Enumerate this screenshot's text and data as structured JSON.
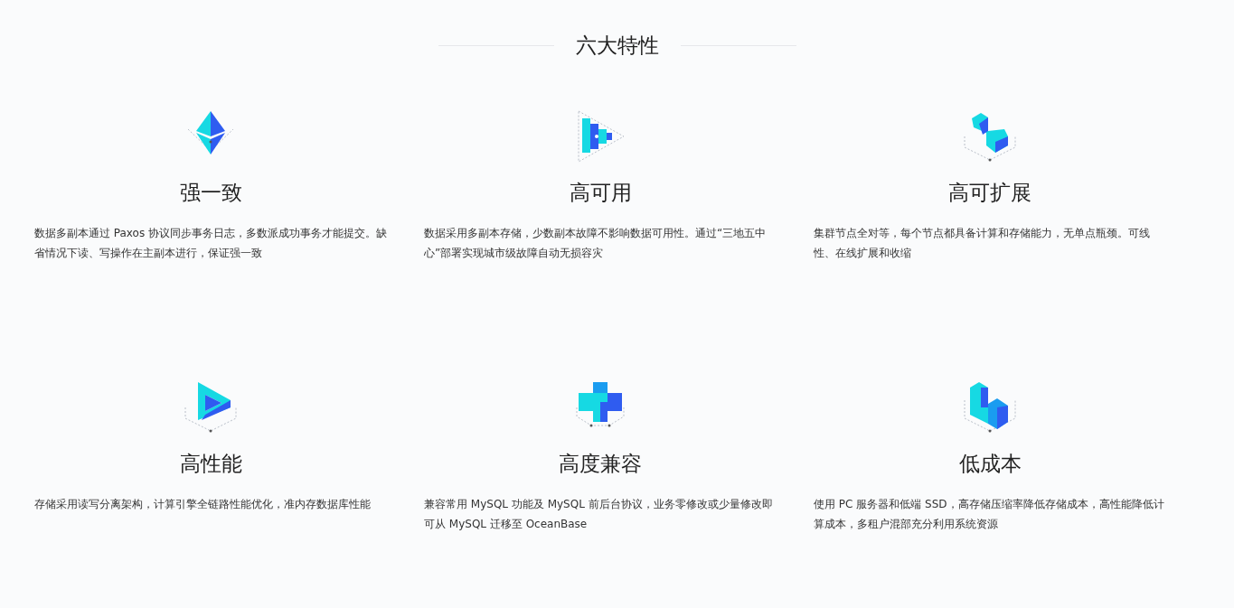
{
  "section": {
    "title": "六大特性"
  },
  "features": [
    {
      "title": "强一致",
      "description": "数据多副本通过 Paxos 协议同步事务日志，多数派成功事务才能提交。缺省情况下读、写操作在主副本进行，保证强一致"
    },
    {
      "title": "高可用",
      "description": "数据采用多副本存储，少数副本故障不影响数据可用性。通过“三地五中心”部署实现城市级故障自动无损容灾"
    },
    {
      "title": "高可扩展",
      "description": "集群节点全对等，每个节点都具备计算和存储能力，无单点瓶颈。可线性、在线扩展和收缩"
    },
    {
      "title": "高性能",
      "description": "存储采用读写分离架构，计算引擎全链路性能优化，准内存数据库性能"
    },
    {
      "title": "高度兼容",
      "description": "兼容常用 MySQL 功能及 MySQL 前后台协议，业务零修改或少量修改即可从 MySQL 迁移至 OceanBase"
    },
    {
      "title": "低成本",
      "description": "使用 PC 服务器和低端 SSD，高存储压缩率降低存储成本，高性能降低计算成本，多租户混部充分利用系统资源"
    }
  ]
}
